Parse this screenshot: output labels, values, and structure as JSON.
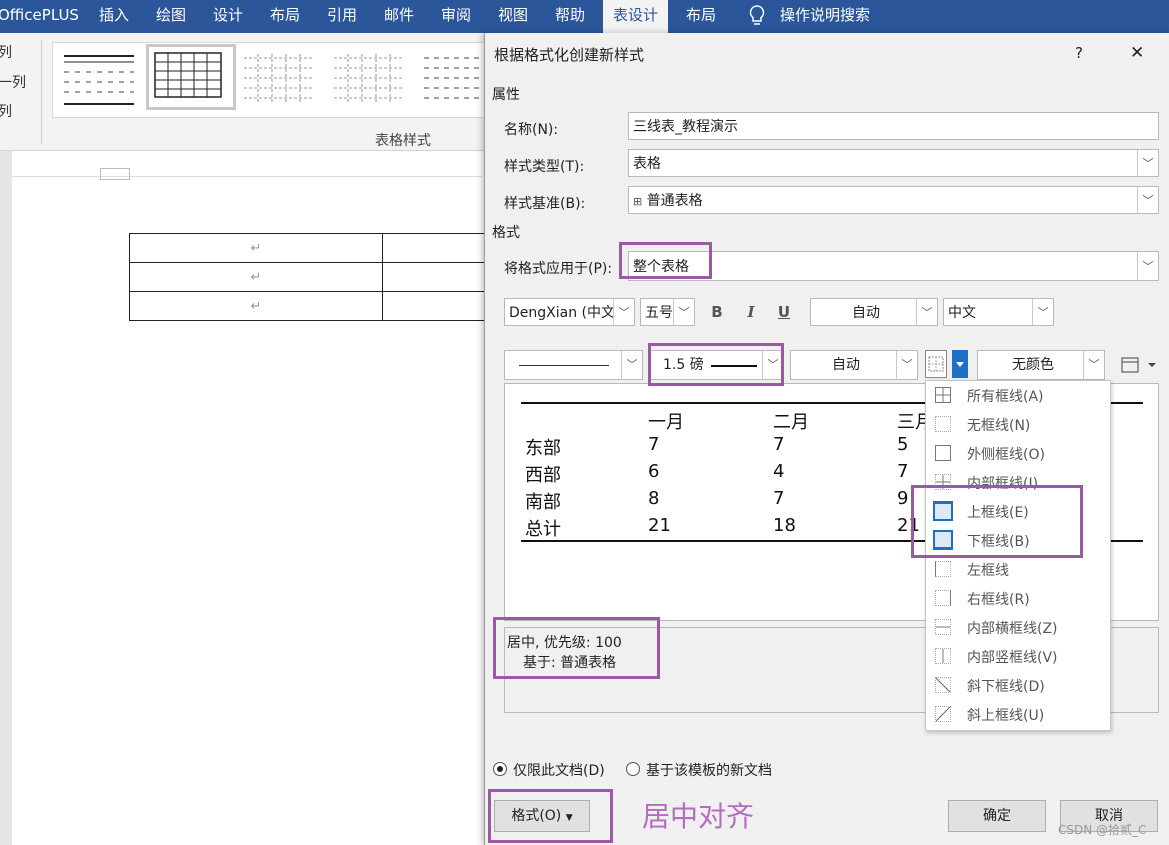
{
  "ribbon": {
    "tabs": [
      "OfficePLUS",
      "插入",
      "绘图",
      "设计",
      "布局",
      "引用",
      "邮件",
      "审阅",
      "视图",
      "帮助",
      "表设计",
      "布局"
    ],
    "active_tab": "表设计",
    "search_label": "操作说明搜索",
    "left_options": [
      "列",
      "一列",
      "列"
    ],
    "gallery_label": "表格样式"
  },
  "dialog": {
    "title": "根据格式化创建新样式",
    "help": "?",
    "close": "✕",
    "properties_heading": "属性",
    "name_label": "名称(N):",
    "name_value": "三线表_教程演示",
    "type_label": "样式类型(T):",
    "type_value": "表格",
    "based_label": "样式基准(B):",
    "based_value": "普通表格",
    "format_heading": "格式",
    "apply_label": "将格式应用于(P):",
    "apply_value": "整个表格",
    "font": "DengXian (中文",
    "size": "五号",
    "bold": "B",
    "italic": "I",
    "underline": "U",
    "font_color": "自动",
    "script": "中文",
    "line_weight": "1.5 磅",
    "line_color": "自动",
    "shading": "无颜色",
    "preview": {
      "headers": [
        "一月",
        "二月",
        "三月"
      ],
      "rows": [
        {
          "label": "东部",
          "values": [
            "7",
            "7",
            "5"
          ]
        },
        {
          "label": "西部",
          "values": [
            "6",
            "4",
            "7"
          ]
        },
        {
          "label": "南部",
          "values": [
            "8",
            "7",
            "9"
          ]
        },
        {
          "label": "总计",
          "values": [
            "21",
            "18",
            "21"
          ]
        }
      ]
    },
    "description_line1": "居中, 优先级: 100",
    "description_line2": "基于: 普通表格",
    "radio_doc_only": "仅限此文档(D)",
    "radio_template": "基于该模板的新文档",
    "format_button": "格式(O)",
    "ok_button": "确定",
    "cancel_button": "取消"
  },
  "border_menu": [
    {
      "label": "所有框线(A)",
      "icon": "all-borders-icon"
    },
    {
      "label": "无框线(N)",
      "icon": "no-border-icon"
    },
    {
      "label": "外侧框线(O)",
      "icon": "outside-borders-icon"
    },
    {
      "label": "内部框线(I)",
      "icon": "inside-borders-icon"
    },
    {
      "label": "上框线(E)",
      "icon": "top-border-icon"
    },
    {
      "label": "下框线(B)",
      "icon": "bottom-border-icon"
    },
    {
      "label": "左框线",
      "icon": "left-border-icon"
    },
    {
      "label": "右框线(R)",
      "icon": "right-border-icon"
    },
    {
      "label": "内部横框线(Z)",
      "icon": "inside-horizontal-border-icon"
    },
    {
      "label": "内部竖框线(V)",
      "icon": "inside-vertical-border-icon"
    },
    {
      "label": "斜下框线(D)",
      "icon": "diagonal-down-border-icon"
    },
    {
      "label": "斜上框线(U)",
      "icon": "diagonal-up-border-icon"
    }
  ],
  "annotation": "居中对齐",
  "watermark": "CSDN @拾贰_C",
  "colors": {
    "ribbon": "#2b579a",
    "highlight": "#9b59a3",
    "accent": "#1e70c6"
  }
}
